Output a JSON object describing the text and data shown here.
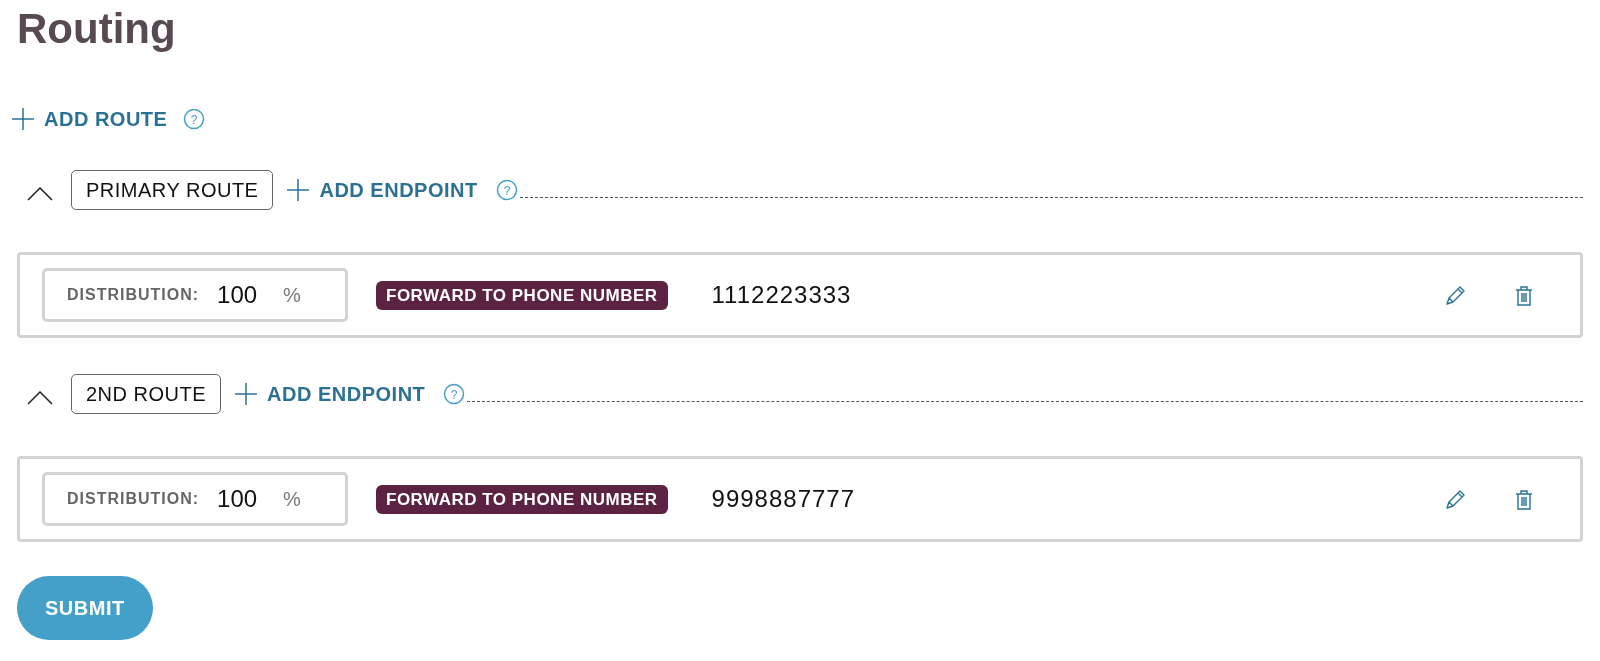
{
  "title": "Routing",
  "add_route": {
    "label": "ADD ROUTE",
    "help": "?"
  },
  "routes": [
    {
      "name": "PRIMARY ROUTE",
      "expanded": true,
      "add_endpoint": "ADD ENDPOINT",
      "help": "?",
      "endpoints": [
        {
          "distribution_label": "DISTRIBUTION:",
          "distribution": "100",
          "unit": "%",
          "type": "FORWARD TO PHONE NUMBER",
          "number": "1112223333"
        }
      ]
    },
    {
      "name": "2ND ROUTE",
      "expanded": true,
      "add_endpoint": "ADD ENDPOINT",
      "help": "?",
      "endpoints": [
        {
          "distribution_label": "DISTRIBUTION:",
          "distribution": "100",
          "unit": "%",
          "type": "FORWARD TO PHONE NUMBER",
          "number": "9998887777"
        }
      ]
    }
  ],
  "submit": "SUBMIT"
}
